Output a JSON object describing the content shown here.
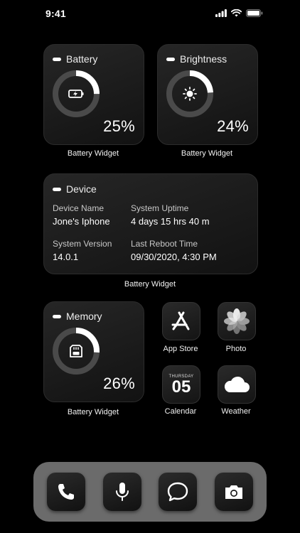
{
  "status_bar": {
    "time": "9:41"
  },
  "widgets": {
    "battery": {
      "title": "Battery",
      "percent_label": "25%",
      "level": 0.25,
      "caption": "Battery Widget"
    },
    "brightness": {
      "title": "Brightness",
      "percent_label": "24%",
      "level": 0.24,
      "caption": "Battery Widget"
    },
    "device": {
      "title": "Device",
      "caption": "Battery Widget",
      "device_name_label": "Device Name",
      "device_name_value": "Jone's Iphone",
      "system_uptime_label": "System Uptime",
      "system_uptime_value": "4 days 15 hrs 40 m",
      "system_version_label": "System Version",
      "system_version_value": "14.0.1",
      "last_reboot_label": "Last Reboot Time",
      "last_reboot_value": "09/30/2020, 4:30 PM"
    },
    "memory": {
      "title": "Memory",
      "percent_label": "26%",
      "level": 0.26,
      "caption": "Battery Widget"
    }
  },
  "apps": {
    "app_store": {
      "label": "App Store",
      "icon": "app-store-icon"
    },
    "photo": {
      "label": "Photo",
      "icon": "photo-flower-icon"
    },
    "calendar": {
      "label": "Calendar",
      "icon": "calendar-icon",
      "weekday": "THURSDAY",
      "day": "05"
    },
    "weather": {
      "label": "Weather",
      "icon": "cloud-icon"
    }
  },
  "dock": {
    "items": [
      {
        "name": "phone",
        "icon": "phone-icon"
      },
      {
        "name": "microphone",
        "icon": "microphone-icon"
      },
      {
        "name": "messages",
        "icon": "message-bubble-icon"
      },
      {
        "name": "camera",
        "icon": "camera-icon"
      }
    ]
  },
  "colors": {
    "background": "#000000",
    "card": "#1e1e1e",
    "ring_track": "#4a4a4a",
    "ring_fill": "#ffffff",
    "dock": "#6b6b6b"
  }
}
